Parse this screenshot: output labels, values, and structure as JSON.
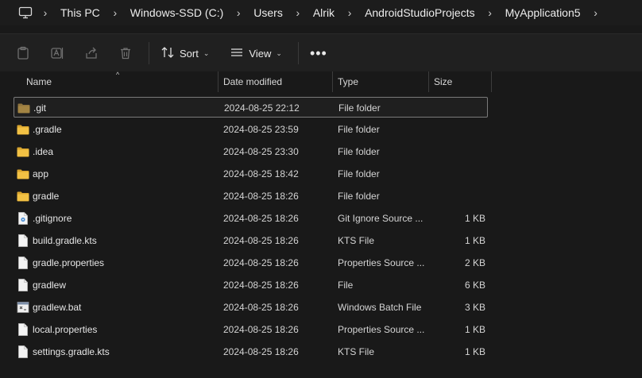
{
  "breadcrumb": {
    "items": [
      "This PC",
      "Windows-SSD (C:)",
      "Users",
      "Alrik",
      "AndroidStudioProjects",
      "MyApplication5"
    ]
  },
  "toolbar": {
    "sort_label": "Sort",
    "view_label": "View",
    "more_label": "•••"
  },
  "columns": {
    "name": "Name",
    "date": "Date modified",
    "type": "Type",
    "size": "Size"
  },
  "files": [
    {
      "name": ".git",
      "date": "2024-08-25 22:12",
      "type": "File folder",
      "size": "",
      "icon": "folder-icon"
    },
    {
      "name": ".gradle",
      "date": "2024-08-25 23:59",
      "type": "File folder",
      "size": "",
      "icon": "folder-icon"
    },
    {
      "name": ".idea",
      "date": "2024-08-25 23:30",
      "type": "File folder",
      "size": "",
      "icon": "folder-icon"
    },
    {
      "name": "app",
      "date": "2024-08-25 18:42",
      "type": "File folder",
      "size": "",
      "icon": "folder-icon"
    },
    {
      "name": "gradle",
      "date": "2024-08-25 18:26",
      "type": "File folder",
      "size": "",
      "icon": "folder-icon"
    },
    {
      "name": ".gitignore",
      "date": "2024-08-25 18:26",
      "type": "Git Ignore Source ...",
      "size": "1 KB",
      "icon": "gitignore-file-icon"
    },
    {
      "name": "build.gradle.kts",
      "date": "2024-08-25 18:26",
      "type": "KTS File",
      "size": "1 KB",
      "icon": "file-icon"
    },
    {
      "name": "gradle.properties",
      "date": "2024-08-25 18:26",
      "type": "Properties Source ...",
      "size": "2 KB",
      "icon": "file-icon"
    },
    {
      "name": "gradlew",
      "date": "2024-08-25 18:26",
      "type": "File",
      "size": "6 KB",
      "icon": "file-icon"
    },
    {
      "name": "gradlew.bat",
      "date": "2024-08-25 18:26",
      "type": "Windows Batch File",
      "size": "3 KB",
      "icon": "batch-file-icon"
    },
    {
      "name": "local.properties",
      "date": "2024-08-25 18:26",
      "type": "Properties Source ...",
      "size": "1 KB",
      "icon": "file-icon"
    },
    {
      "name": "settings.gradle.kts",
      "date": "2024-08-25 18:26",
      "type": "KTS File",
      "size": "1 KB",
      "icon": "file-icon"
    }
  ],
  "colors": {
    "background": "#191919",
    "folder": "#e8b53a",
    "git_folder": "#9a7a3a",
    "text": "#e6e6e6"
  }
}
